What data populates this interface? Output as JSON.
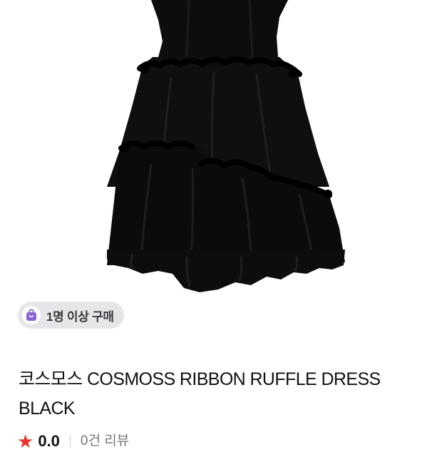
{
  "badge": {
    "label": "1명 이상 구매",
    "icon": "shopping-bag-icon",
    "accent_color": "#8a63d2"
  },
  "product": {
    "title": "코스모스 COSMOSS RIBBON RUFFLE DRESS BLACK",
    "image": "black-ruffle-dress"
  },
  "rating": {
    "star_icon": "star-icon",
    "star_color": "#e8322c",
    "value": "0.0",
    "reviews_label": "0건 리뷰"
  }
}
